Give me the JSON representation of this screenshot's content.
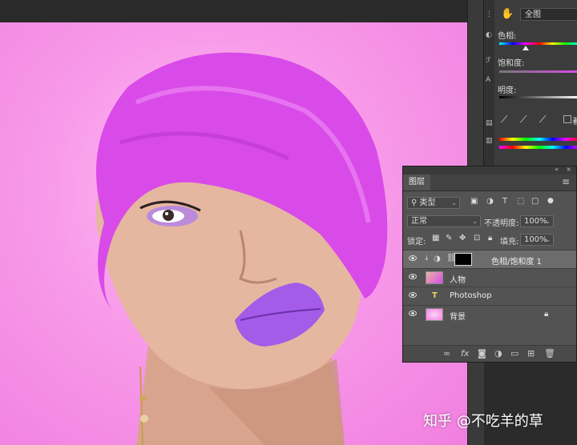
{
  "adjustments": {
    "preset": "全图",
    "hue_label": "色相:",
    "saturation_label": "饱和度:",
    "lightness_label": "明度:",
    "colorize_label": "着"
  },
  "layers_panel": {
    "tab": "图层",
    "filter_kind": "类型",
    "blend_mode": "正常",
    "opacity_label": "不透明度:",
    "opacity_value": "100%",
    "lock_label": "锁定:",
    "fill_label": "填充:",
    "fill_value": "100%",
    "layers": [
      {
        "name": "色相/饱和度 1",
        "type": "adjustment",
        "active": true
      },
      {
        "name": "人物",
        "type": "image",
        "active": false
      },
      {
        "name": "Photoshop",
        "type": "text",
        "active": false
      },
      {
        "name": "背景",
        "type": "fill",
        "locked": true,
        "active": false
      }
    ]
  },
  "watermark": "知乎 @不吃羊的草",
  "colors": {
    "canvas_bg": "#f59be7",
    "hair": "#d94be8",
    "lips": "#a35be8",
    "panel_bg": "#535353"
  }
}
